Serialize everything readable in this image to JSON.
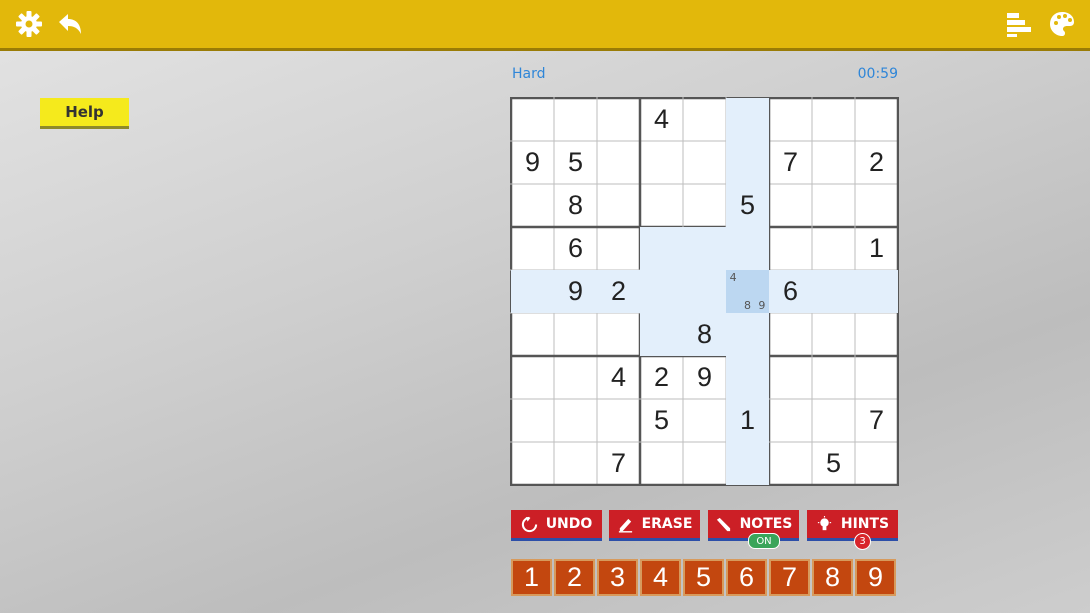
{
  "toolbar": {
    "settings_icon": "gear-icon",
    "back_icon": "undo-arrow-icon",
    "stats_icon": "bars-icon",
    "theme_icon": "palette-icon",
    "color": "#e2b80b"
  },
  "help": {
    "label": "Help"
  },
  "game": {
    "difficulty": "Hard",
    "timer": "00:59"
  },
  "board": {
    "values": [
      [
        "",
        "",
        "",
        "4",
        "",
        "",
        "",
        "",
        ""
      ],
      [
        "9",
        "5",
        "",
        "",
        "",
        "",
        "7",
        "",
        "2"
      ],
      [
        "",
        "8",
        "",
        "",
        "",
        "5",
        "",
        "",
        ""
      ],
      [
        "",
        "6",
        "",
        "",
        "",
        "",
        "",
        "",
        "1"
      ],
      [
        "",
        "9",
        "2",
        "",
        "",
        "",
        "6",
        "",
        ""
      ],
      [
        "",
        "",
        "",
        "",
        "8",
        "",
        "",
        "",
        ""
      ],
      [
        "",
        "",
        "4",
        "2",
        "9",
        "",
        "",
        "",
        ""
      ],
      [
        "",
        "",
        "",
        "5",
        "",
        "1",
        "",
        "",
        "7"
      ],
      [
        "",
        "",
        "7",
        "",
        "",
        "",
        "",
        "5",
        ""
      ]
    ],
    "selected": {
      "row": 4,
      "col": 5
    },
    "notes": {
      "cell": "r4c5",
      "values": [
        "4",
        "",
        "",
        "",
        "",
        "",
        "",
        "8",
        "9"
      ]
    },
    "highlight_color": "#e3effb",
    "selected_color": "#bcd7f1"
  },
  "controls": {
    "undo": "UNDO",
    "erase": "ERASE",
    "notes": "NOTES",
    "notes_state": "ON",
    "hints": "HINTS",
    "hints_count": "3"
  },
  "numpad": [
    "1",
    "2",
    "3",
    "4",
    "5",
    "6",
    "7",
    "8",
    "9"
  ]
}
